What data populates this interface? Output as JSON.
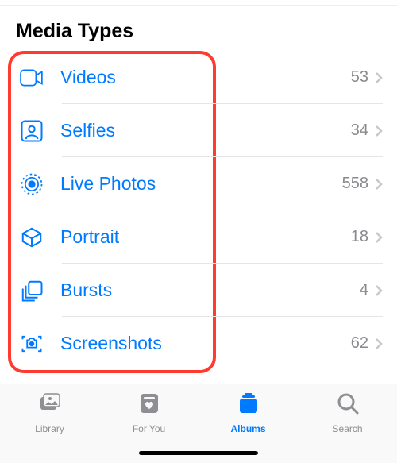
{
  "header": {
    "title": "Media Types"
  },
  "rows": [
    {
      "icon": "video-icon",
      "label": "Videos",
      "count": "53"
    },
    {
      "icon": "selfie-icon",
      "label": "Selfies",
      "count": "34"
    },
    {
      "icon": "livephoto-icon",
      "label": "Live Photos",
      "count": "558"
    },
    {
      "icon": "portrait-icon",
      "label": "Portrait",
      "count": "18"
    },
    {
      "icon": "bursts-icon",
      "label": "Bursts",
      "count": "4"
    },
    {
      "icon": "screenshot-icon",
      "label": "Screenshots",
      "count": "62"
    }
  ],
  "tabs": [
    {
      "icon": "library-tab-icon",
      "label": "Library",
      "active": false
    },
    {
      "icon": "foryou-tab-icon",
      "label": "For You",
      "active": false
    },
    {
      "icon": "albums-tab-icon",
      "label": "Albums",
      "active": true
    },
    {
      "icon": "search-tab-icon",
      "label": "Search",
      "active": false
    }
  ]
}
